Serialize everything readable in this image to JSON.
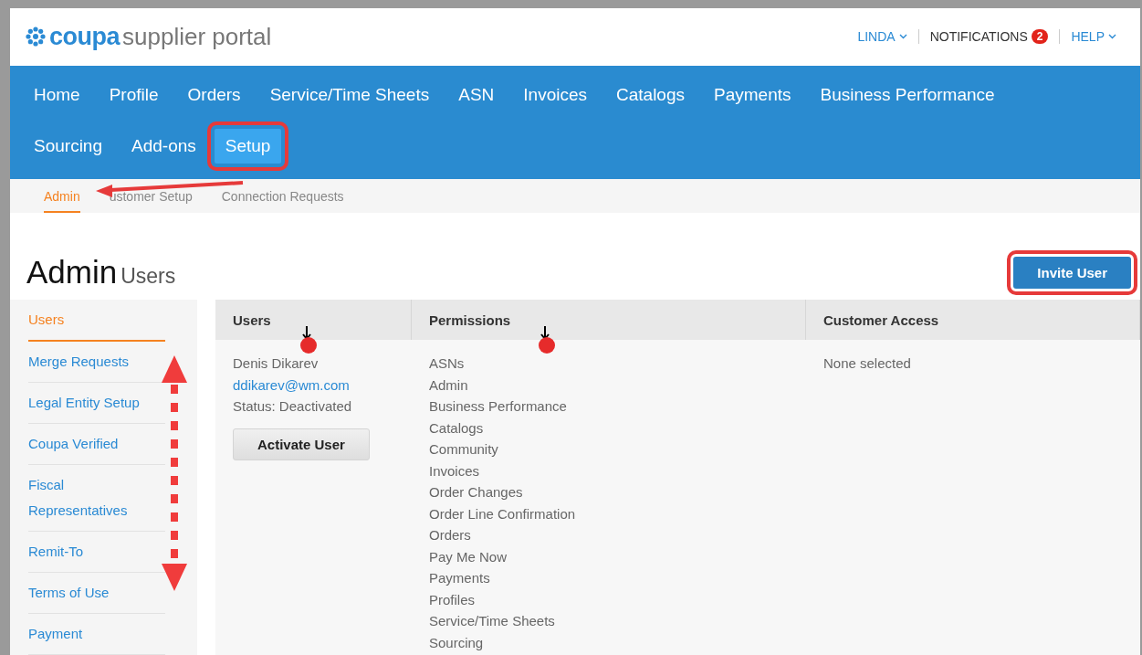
{
  "header": {
    "logo_bold": "coupa",
    "logo_rest": "supplier portal",
    "user_menu": "LINDA",
    "notifications": {
      "label": "NOTIFICATIONS",
      "count": "2"
    },
    "help_menu": "HELP"
  },
  "main_nav": {
    "rows": [
      {
        "items": [
          {
            "label": "Home",
            "selected": false
          },
          {
            "label": "Profile",
            "selected": false
          },
          {
            "label": "Orders",
            "selected": false
          },
          {
            "label": "Service/Time Sheets",
            "selected": false
          },
          {
            "label": "ASN",
            "selected": false
          },
          {
            "label": "Invoices",
            "selected": false
          },
          {
            "label": "Catalogs",
            "selected": false
          },
          {
            "label": "Payments",
            "selected": false
          },
          {
            "label": "Business Performance",
            "selected": false
          }
        ]
      },
      {
        "items": [
          {
            "label": "Sourcing",
            "selected": false
          },
          {
            "label": "Add-ons",
            "selected": false
          },
          {
            "label": "Setup",
            "selected": true
          }
        ]
      }
    ]
  },
  "sub_nav": [
    {
      "label": "Admin",
      "selected": true
    },
    {
      "label": "ustomer Setup",
      "selected": false
    },
    {
      "label": "Connection Requests",
      "selected": false
    }
  ],
  "page_title": {
    "title": "Admin",
    "subtitle": "Users"
  },
  "invite_button": "Invite User",
  "sidebar": [
    {
      "label": "Users",
      "selected": true
    },
    {
      "label": "Merge Requests",
      "selected": false
    },
    {
      "label": "Legal Entity Setup",
      "selected": false
    },
    {
      "label": "Coupa Verified",
      "selected": false
    },
    {
      "label": "Fiscal Representatives",
      "selected": false
    },
    {
      "label": "Remit-To",
      "selected": false
    },
    {
      "label": "Terms of Use",
      "selected": false
    },
    {
      "label": "Payment",
      "selected": false
    }
  ],
  "table": {
    "columns": [
      "Users",
      "Permissions",
      "Customer Access"
    ],
    "rows": [
      {
        "name": "Denis Dikarev",
        "email": "ddikarev@wm.com",
        "status": "Status: Deactivated",
        "action": "Activate User",
        "permissions": [
          "ASNs",
          "Admin",
          "Business Performance",
          "Catalogs",
          "Community",
          "Invoices",
          "Order Changes",
          "Order Line Confirmation",
          "Orders",
          "Pay Me Now",
          "Payments",
          "Profiles",
          "Service/Time Sheets",
          "Sourcing"
        ],
        "customer_access": "None selected"
      }
    ]
  }
}
